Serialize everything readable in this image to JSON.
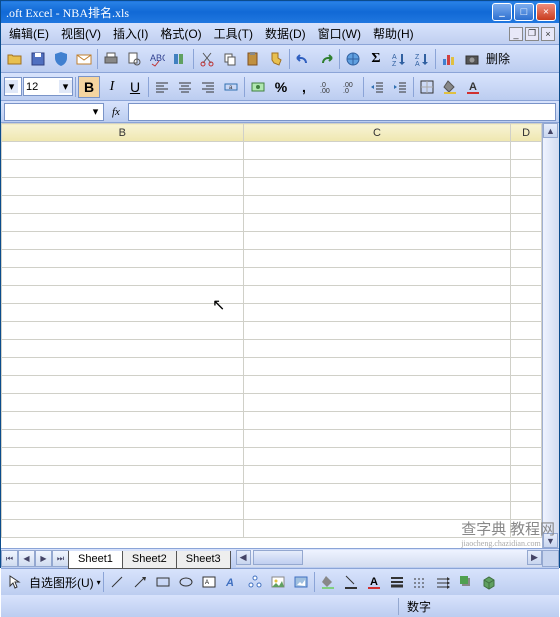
{
  "title": ".oft Excel - NBA排名.xls",
  "menu": {
    "edit": "编辑(E)",
    "view": "视图(V)",
    "insert": "插入(I)",
    "format": "格式(O)",
    "tools": "工具(T)",
    "data": "数据(D)",
    "window": "窗口(W)",
    "help": "帮助(H)"
  },
  "toolbar1": {
    "delete_btn": "删除"
  },
  "formatting": {
    "fontsize": "12",
    "bold": "B",
    "italic": "I",
    "underline": "U"
  },
  "namebox": {
    "value": "",
    "fx": "fx"
  },
  "columns": {
    "B": "B",
    "C": "C",
    "D": "D"
  },
  "tabs": {
    "sheet1": "Sheet1",
    "sheet2": "Sheet2",
    "sheet3": "Sheet3"
  },
  "drawbar": {
    "autoshapes": "自选图形(U)"
  },
  "status": {
    "ready": "",
    "numlock": "数字"
  },
  "watermark": {
    "main": "查字典 教程网",
    "sub": "jiaocheng.chazidian.com"
  }
}
